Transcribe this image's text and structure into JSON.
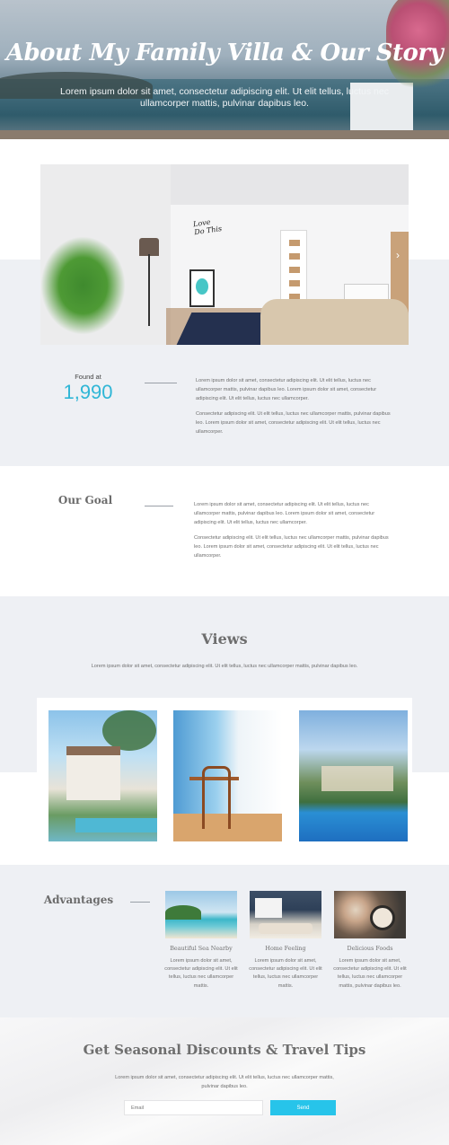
{
  "hero": {
    "title": "About My Family Villa & Our Story",
    "subtitle": "Lorem ipsum dolor sit amet, consectetur adipiscing elit. Ut elit tellus, luctus nec ullamcorper mattis, pulvinar dapibus leo."
  },
  "main_photo": {
    "art_text": "Love Do This",
    "next_arrow": "›"
  },
  "stats": {
    "label": "Found at",
    "value": "1,990",
    "paragraph1": "Lorem ipsum dolor sit amet, consectetur adipiscing elit. Ut elit tellus, luctus nec ullamcorper mattis, pulvinar dapibus leo. Lorem ipsum dolor sit amet, consectetur adipiscing elit. Ut elit tellus, luctus nec ullamcorper.",
    "paragraph2": "Consectetur adipiscing elit. Ut elit tellus, luctus nec ullamcorper mattis, pulvinar dapibus leo. Lorem ipsum dolor sit amet, consectetur adipiscing elit. Ut elit tellus, luctus nec ullamcorper."
  },
  "goal": {
    "title": "Our Goal",
    "paragraph1": "Lorem ipsum dolor sit amet, consectetur adipiscing elit. Ut elit tellus, luctus nec ullamcorper mattis, pulvinar dapibus leo. Lorem ipsum dolor sit amet, consectetur adipiscing elit. Ut elit tellus, luctus nec ullamcorper.",
    "paragraph2": "Consectetur adipiscing elit. Ut elit tellus, luctus nec ullamcorper mattis, pulvinar dapibus leo. Lorem ipsum dolor sit amet, consectetur adipiscing elit. Ut elit tellus, luctus nec ullamcorper."
  },
  "views": {
    "title": "Views",
    "subtitle": "Lorem ipsum dolor sit amet, consectetur adipiscing elit. Ut elit tellus, luctus nec ullamcorper mattis, pulvinar dapibus leo."
  },
  "advantages": {
    "title": "Advantages",
    "items": [
      {
        "name": "Beautiful Sea Nearby",
        "text": "Lorem ipsum dolor sit amet, consectetur adipiscing elit. Ut elit tellus, luctus nec ullamcorper mattis."
      },
      {
        "name": "Home Feeling",
        "text": "Lorem ipsum dolor sit amet, consectetur adipiscing elit. Ut elit tellus, luctus nec ullamcorper mattis."
      },
      {
        "name": "Delicious Foods",
        "text": "Lorem ipsum dolor sit amet, consectetur adipiscing elit. Ut elit tellus, luctus nec ullamcorper mattis, pulvinar dapibus leo."
      }
    ]
  },
  "newsletter": {
    "title": "Get Seasonal Discounts & Travel Tips",
    "subtitle": "Lorem ipsum dolor sit amet, consectetur adipiscing elit. Ut elit tellus, luctus nec ullamcorper mattis, pulvinar dapibus leo.",
    "email_placeholder": "Email",
    "button_label": "Send"
  },
  "colors": {
    "accent": "#2fb6d6",
    "button": "#27c4ea",
    "band": "#eef0f4"
  }
}
